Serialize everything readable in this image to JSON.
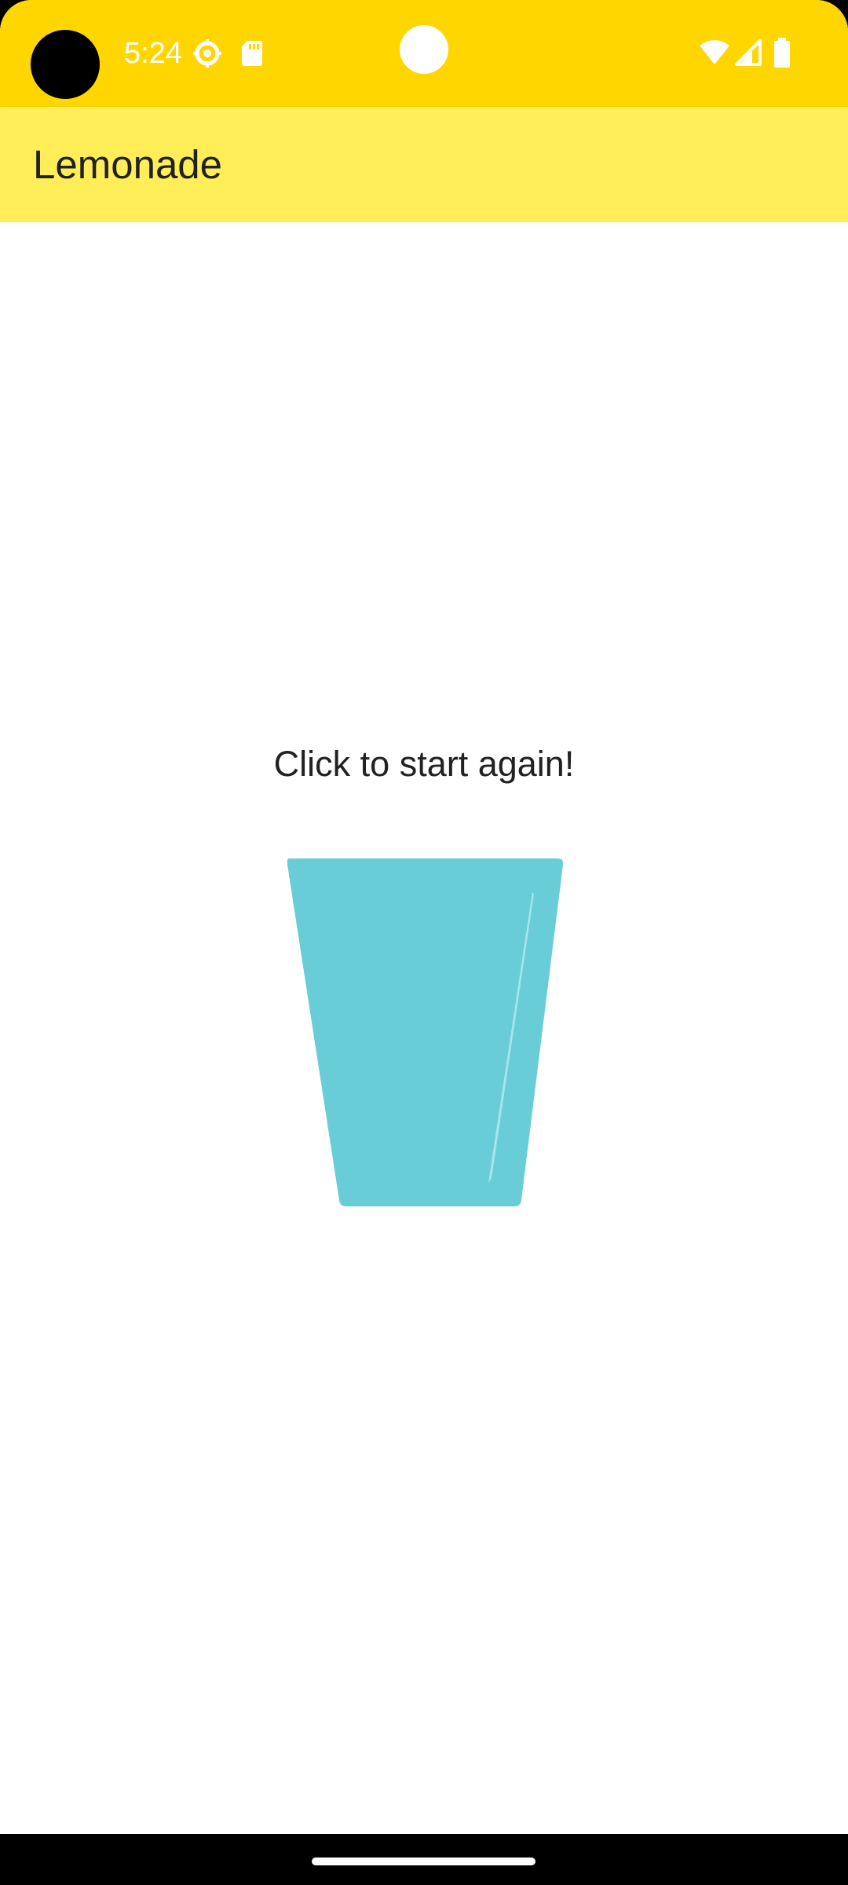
{
  "status_bar": {
    "time": "5:24",
    "icons": [
      "settings-icon",
      "sd-card-icon",
      "wifi-icon",
      "signal-icon",
      "battery-icon"
    ]
  },
  "app_bar": {
    "title": "Lemonade"
  },
  "main": {
    "instruction": "Click to start again!",
    "image": "empty-glass-icon"
  },
  "colors": {
    "status_bar": "#FFD600",
    "app_bar": "#FFEE58",
    "glass": "#69CDD8",
    "glass_highlight": "#A8E6EE",
    "text": "#212121"
  }
}
